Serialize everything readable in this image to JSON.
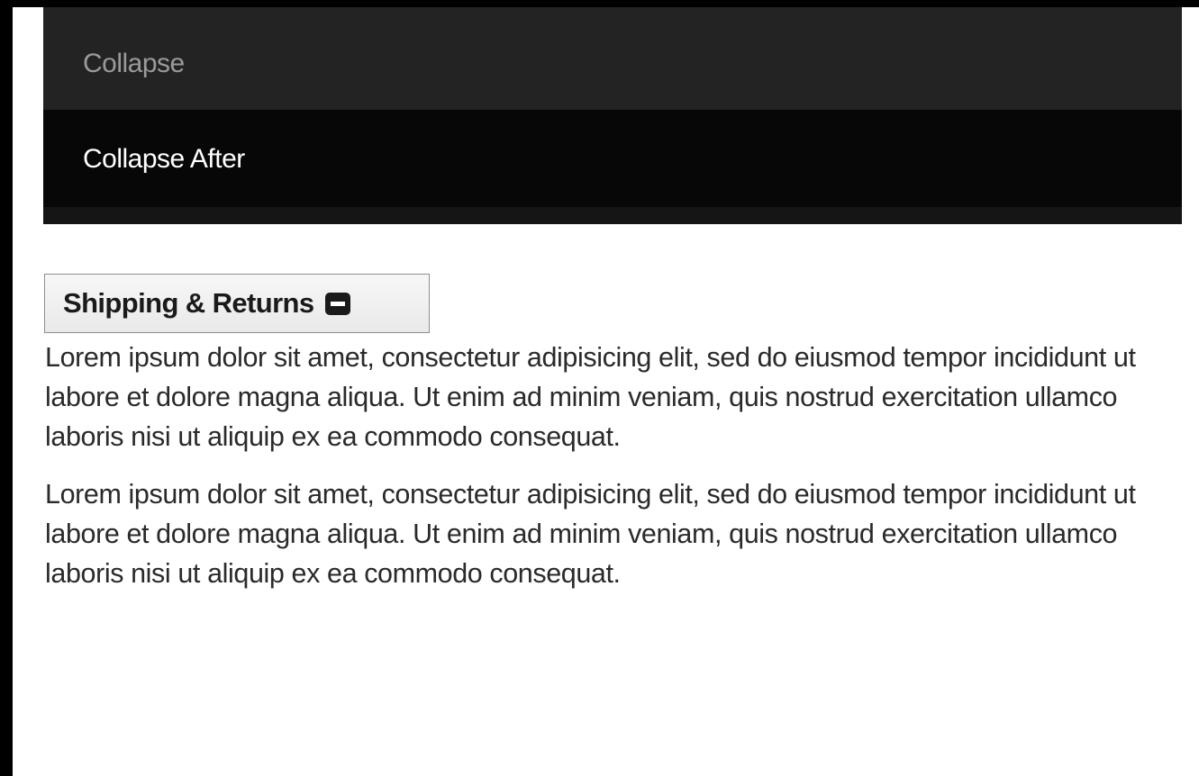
{
  "nav": {
    "items": [
      {
        "label": "Collapse"
      },
      {
        "label": "Collapse After"
      }
    ]
  },
  "toggle": {
    "label": "Shipping & Returns",
    "icon": "minus-square-icon"
  },
  "content": {
    "paragraphs": [
      "Lorem ipsum dolor sit amet, consectetur adipisicing elit, sed do eiusmod tempor incididunt ut labore et dolore magna aliqua. Ut enim ad minim veniam, quis nostrud exercitation ullamco laboris nisi ut aliquip ex ea commodo consequat.",
      "Lorem ipsum dolor sit amet, consectetur adipisicing elit, sed do eiusmod tempor incididunt ut labore et dolore magna aliqua. Ut enim ad minim veniam, quis nostrud exercitation ullamco laboris nisi ut aliquip ex ea commodo consequat."
    ]
  },
  "colors": {
    "nav_background": "#151515",
    "nav_item_collapse_bg": "#232323",
    "nav_item_active_bg": "#070707",
    "text": "#2a2a2a"
  }
}
